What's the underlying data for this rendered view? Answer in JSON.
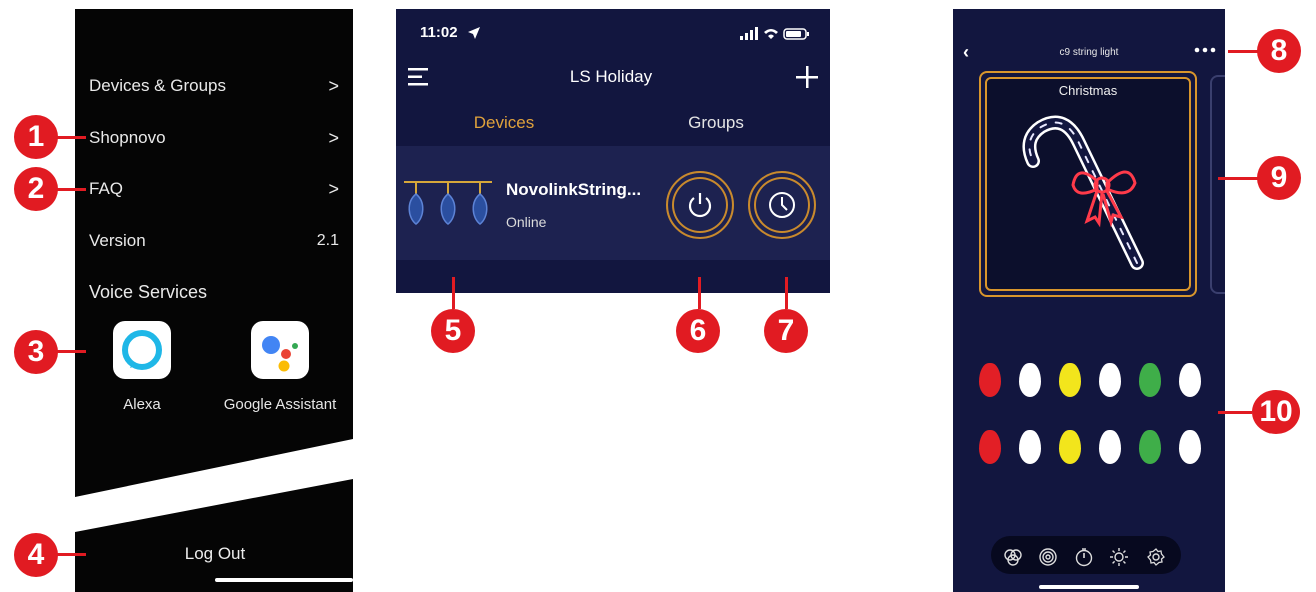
{
  "menu": {
    "items": [
      {
        "label": "Devices & Groups",
        "chevron": ">"
      },
      {
        "label": "Shopnovo",
        "chevron": ">"
      },
      {
        "label": "FAQ",
        "chevron": ">"
      },
      {
        "label": "Version",
        "value": "2.1"
      }
    ],
    "voice_services": {
      "title": "Voice Services",
      "services": [
        {
          "label": "Alexa",
          "icon": "alexa-icon"
        },
        {
          "label": "Google Assistant",
          "icon": "google-assistant-icon"
        }
      ]
    },
    "logout_label": "Log Out"
  },
  "device_screen": {
    "status_time": "11:02",
    "title": "LS Holiday",
    "tabs": [
      {
        "label": "Devices",
        "active": true
      },
      {
        "label": "Groups",
        "active": false
      }
    ],
    "device": {
      "name": "NovolinkString...",
      "status": "Online",
      "icon": "string-lights-icon"
    },
    "colors": {
      "background": "#12163f",
      "row": "#1d2250",
      "accent": "#c98a2d",
      "active_tab": "#e0a23c"
    }
  },
  "editor_screen": {
    "title": "c9 string light",
    "scene_label": "Christmas",
    "bulb_colors": [
      [
        "#e21f26",
        "#ffffff",
        "#f2e51c",
        "#ffffff",
        "#3fae49",
        "#ffffff"
      ],
      [
        "#e21f26",
        "#ffffff",
        "#f2e51c",
        "#ffffff",
        "#3fae49",
        "#ffffff"
      ]
    ],
    "toolbar_icons": [
      "color-mix-icon",
      "rings-icon",
      "timer-icon",
      "brightness-icon",
      "settings-icon"
    ]
  },
  "callouts": [
    "1",
    "2",
    "3",
    "4",
    "5",
    "6",
    "7",
    "8",
    "9",
    "10"
  ],
  "colors": {
    "callout": "#e11b22"
  }
}
